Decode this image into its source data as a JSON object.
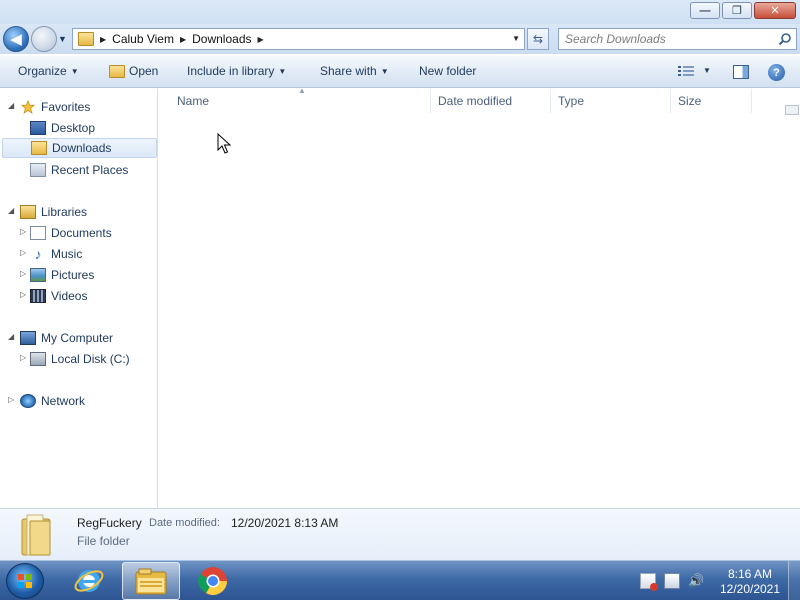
{
  "window": {
    "controls": {
      "minimize": "—",
      "maximize": "❐",
      "close": "✕"
    }
  },
  "address": {
    "crumbs": [
      "Calub Viem",
      "Downloads"
    ],
    "separator": "▶"
  },
  "search": {
    "placeholder": "Search Downloads"
  },
  "toolbar": {
    "organize": "Organize",
    "open": "Open",
    "include_in_library": "Include in library",
    "share_with": "Share with",
    "new_folder": "New folder",
    "help": "?"
  },
  "sidebar": {
    "groups": [
      {
        "label": "Favorites",
        "icon": "star-icon",
        "children": [
          "Desktop",
          "Downloads",
          "Recent Places"
        ]
      },
      {
        "label": "Libraries",
        "icon": "libraries-icon",
        "children": [
          "Documents",
          "Music",
          "Pictures",
          "Videos"
        ]
      },
      {
        "label": "My Computer",
        "icon": "computer-icon",
        "children": [
          "Local Disk (C:)"
        ]
      },
      {
        "label": "Network",
        "icon": "network-icon",
        "children": []
      }
    ],
    "selected": "Downloads"
  },
  "columns": [
    "Name",
    "Date modified",
    "Type",
    "Size"
  ],
  "details": {
    "name": "RegFuckery",
    "date_label": "Date modified:",
    "date_value": "12/20/2021 8:13 AM",
    "type": "File folder"
  },
  "taskbar": {
    "apps": [
      "internet-explorer-icon",
      "windows-explorer-icon",
      "chrome-icon"
    ],
    "active_app": "windows-explorer-icon",
    "time": "8:16 AM",
    "date": "12/20/2021"
  }
}
